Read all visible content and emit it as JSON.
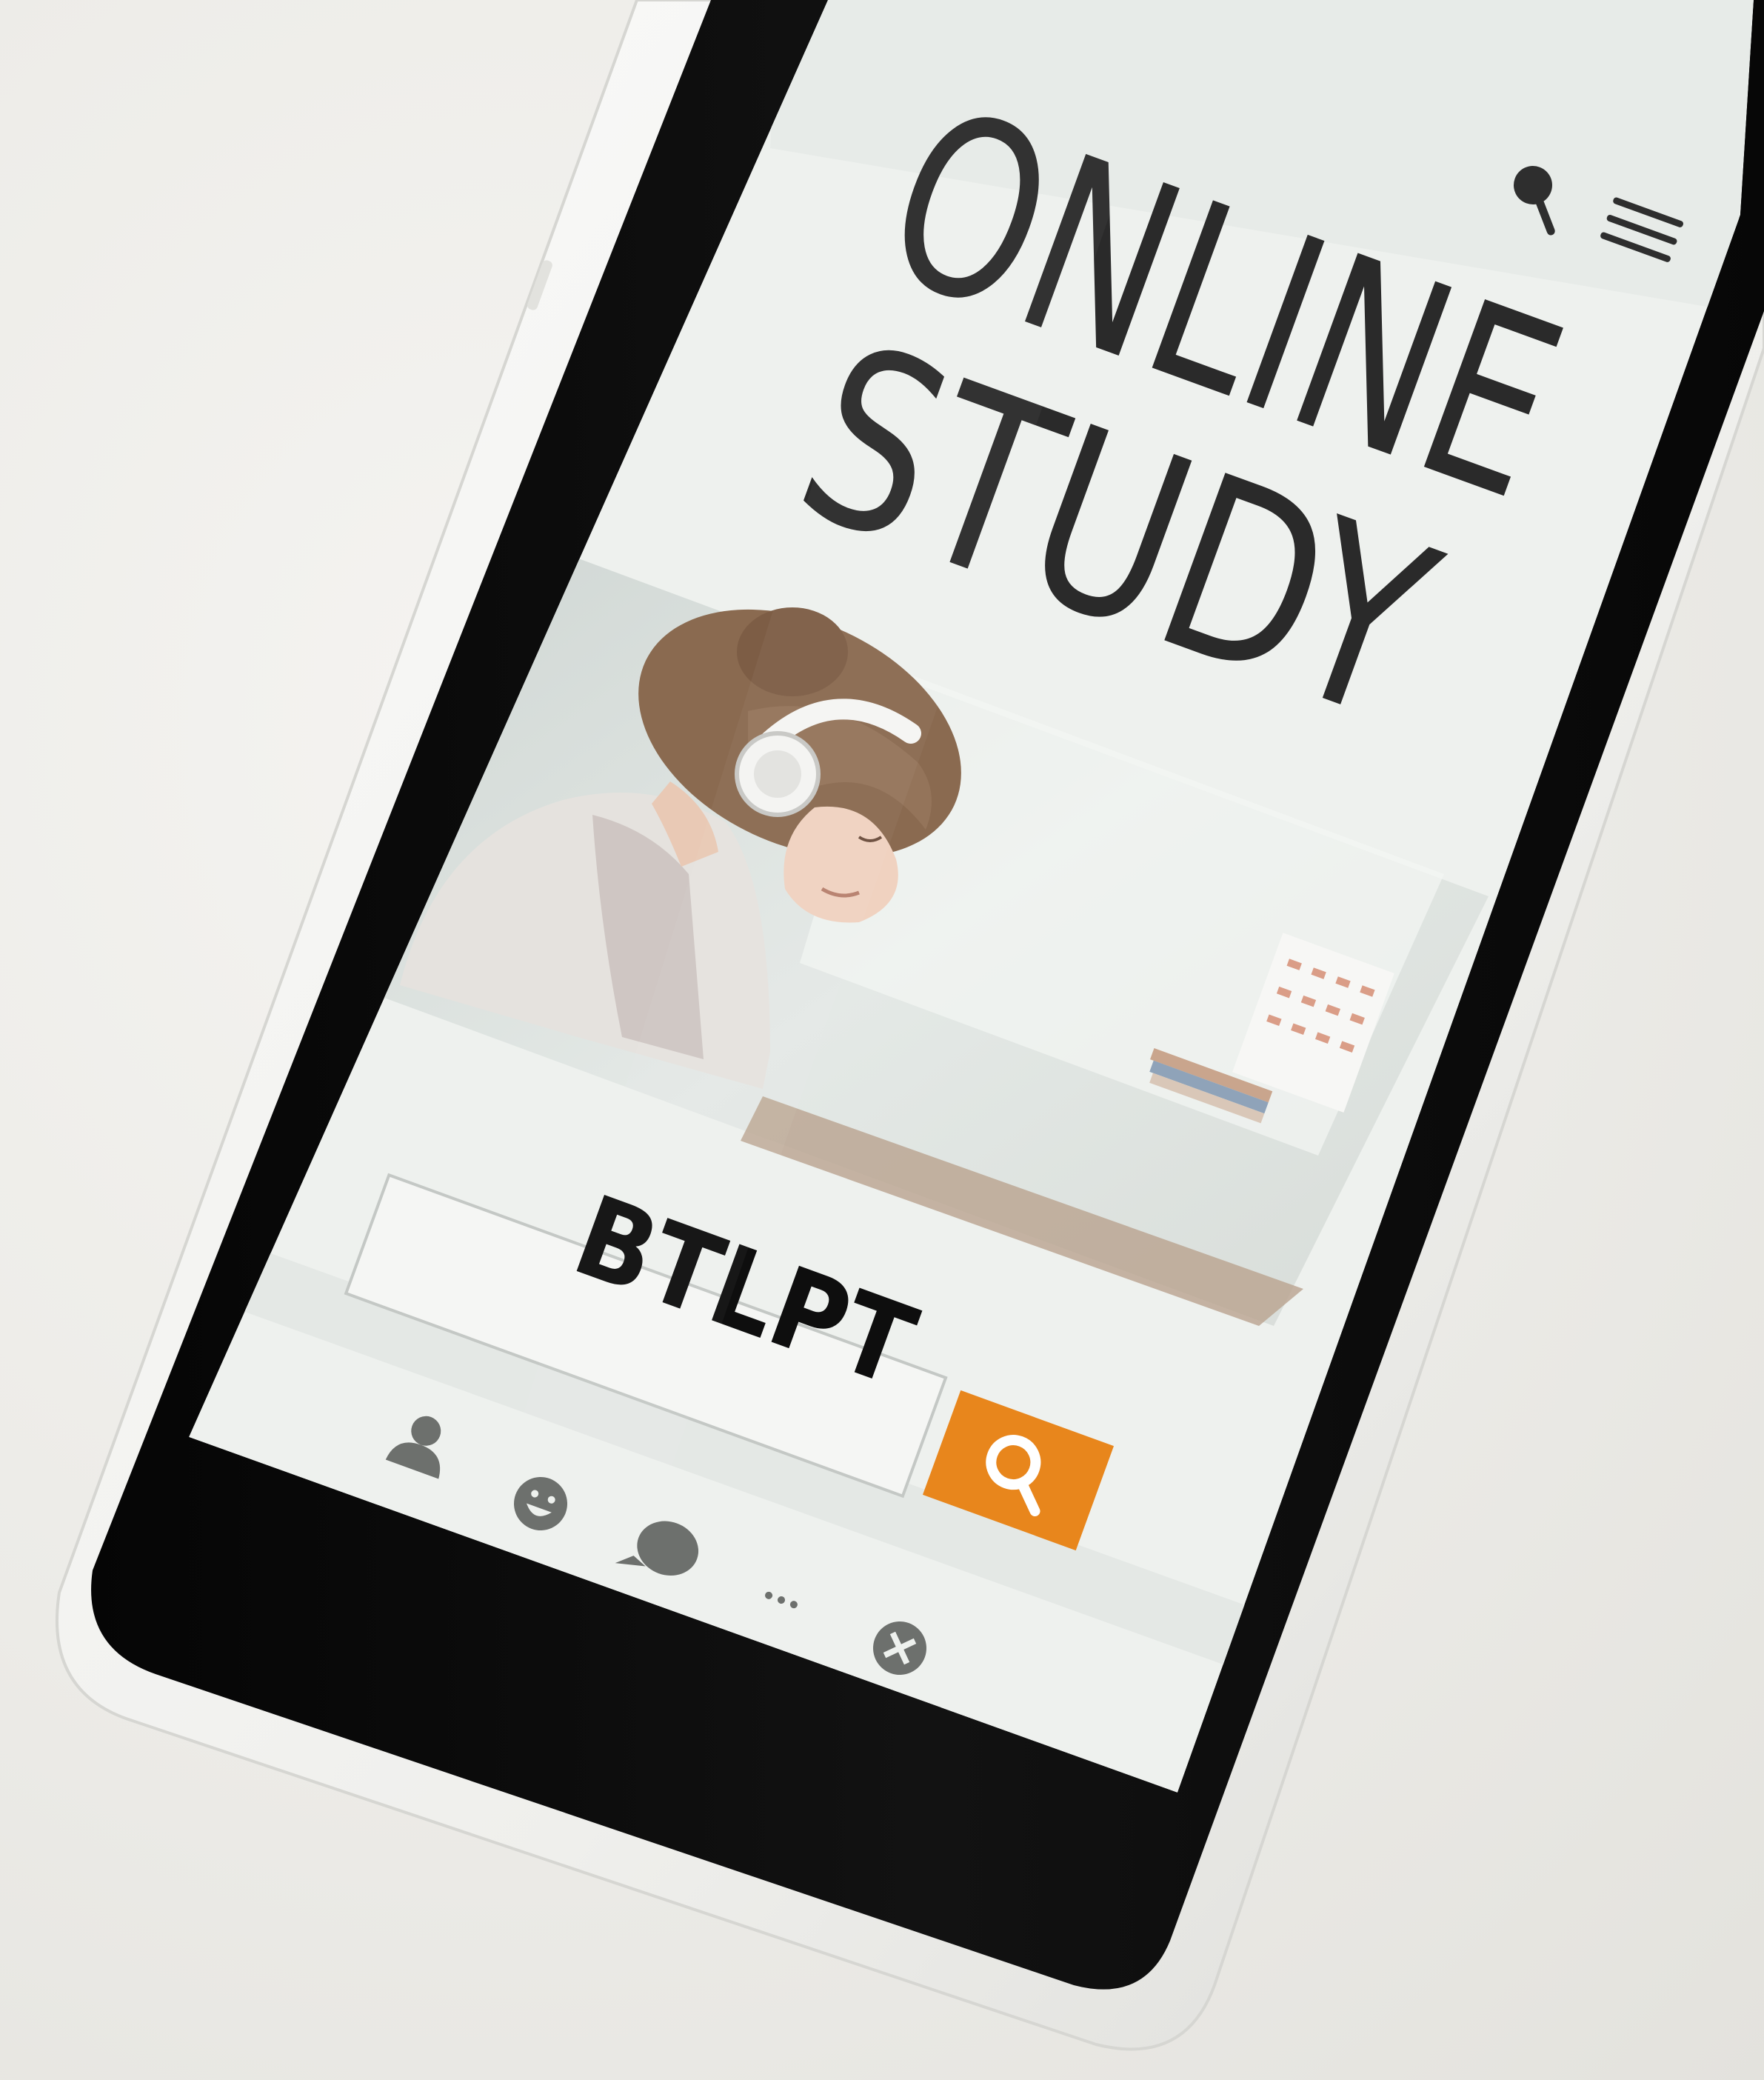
{
  "screen": {
    "headline_line1": "ONLINE",
    "headline_line2": "STUDY",
    "search_label": "BTLPT",
    "colors": {
      "bezel": "#0b0b0b",
      "phone_shell": "#f3f3f1",
      "screen_bg": "#eef1ee",
      "accent": "#e8861c",
      "icon_gray": "#6d706d",
      "headline": "#2a2a2a"
    },
    "top_icons": [
      "search-icon",
      "menu-icon"
    ],
    "bottom_nav": [
      "user-icon",
      "smiley-icon",
      "chat-bubble-icon",
      "more-dots-icon",
      "close-circle-icon"
    ],
    "photo_subject": "woman-with-headphones"
  }
}
